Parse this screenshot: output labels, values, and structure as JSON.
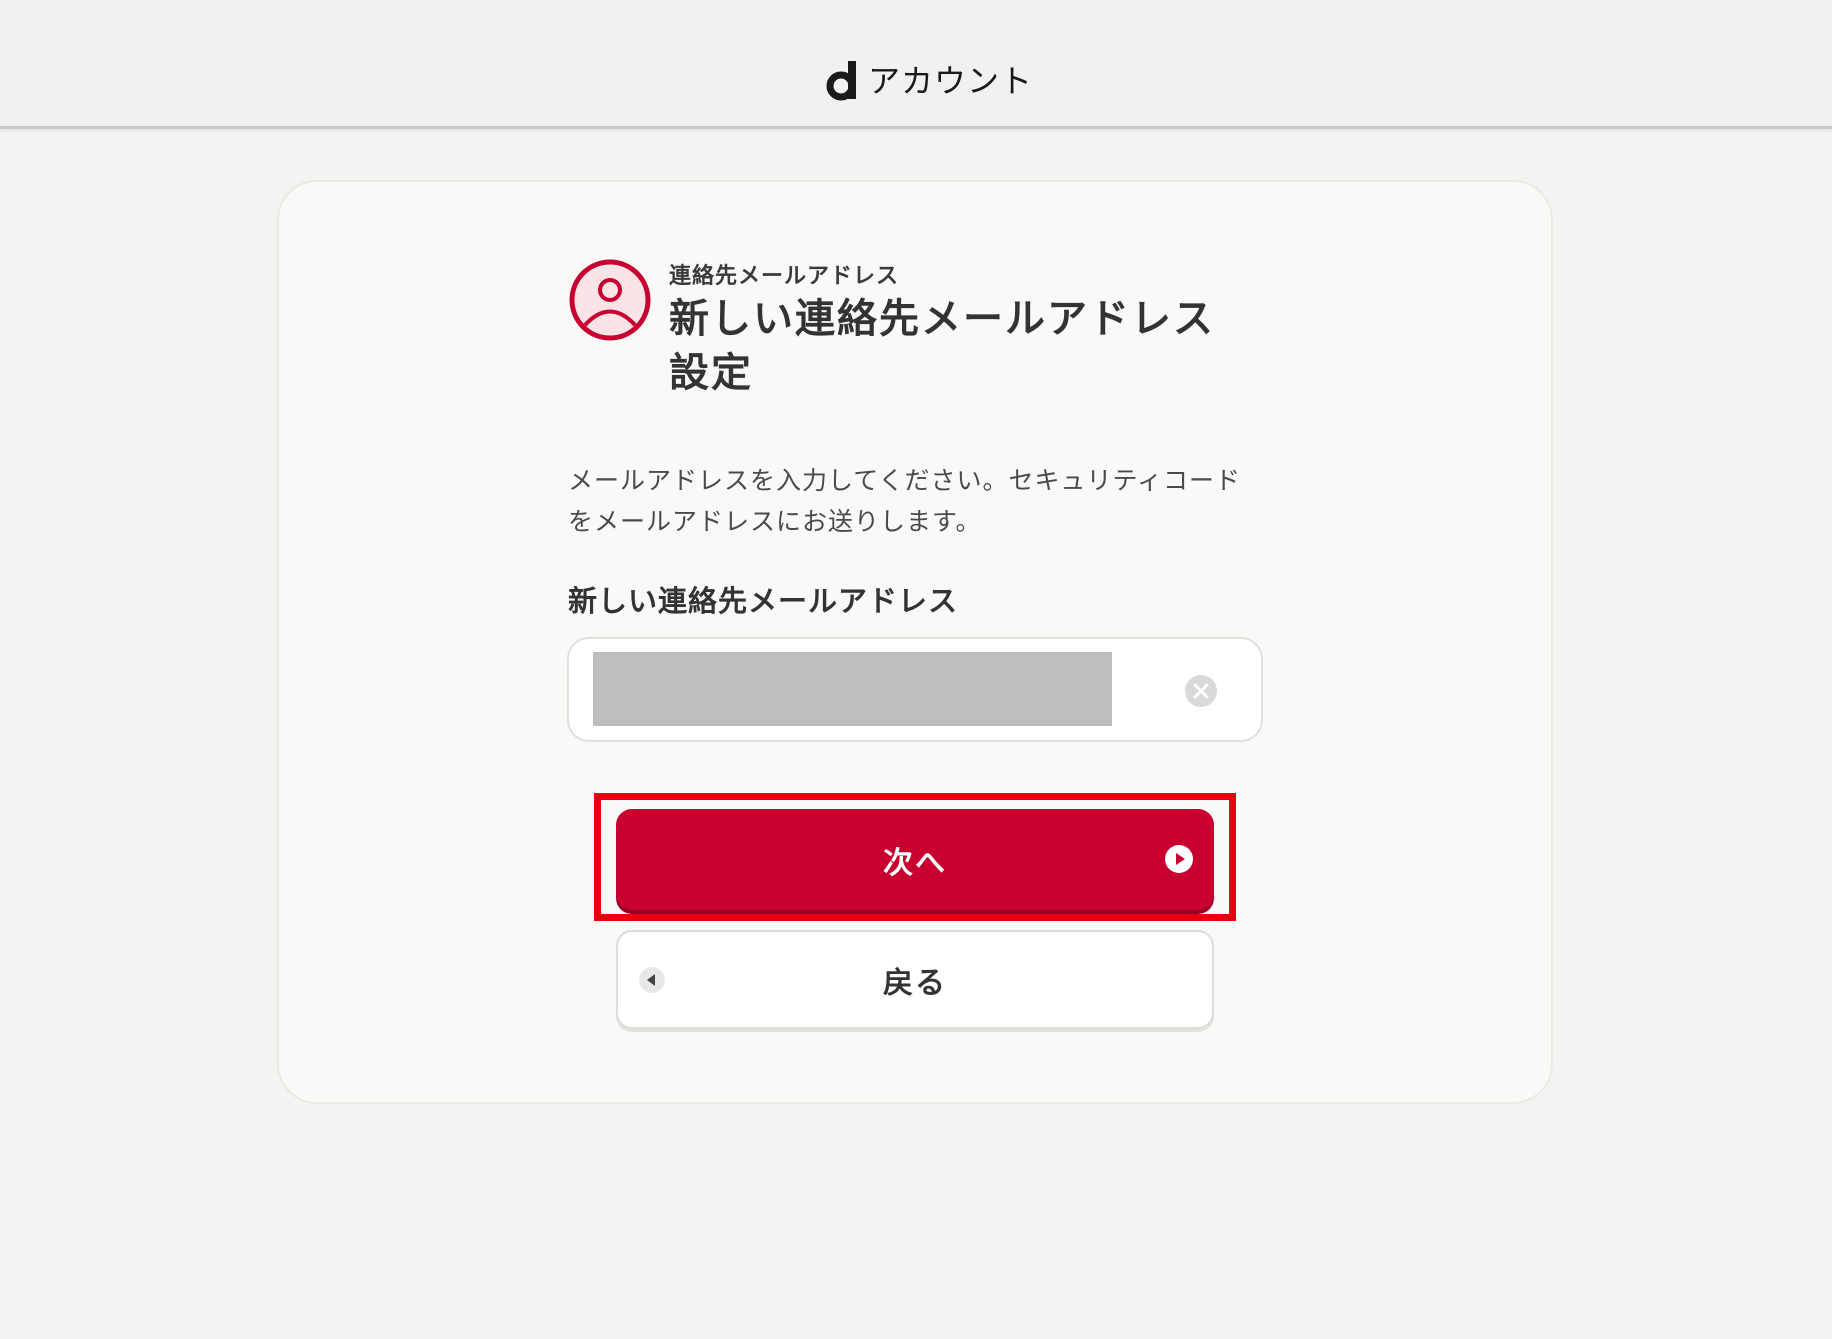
{
  "header": {
    "logo_letter": "d",
    "logo_text": "アカウント"
  },
  "card": {
    "icon": "user-circle-icon",
    "subtitle": "連絡先メールアドレス",
    "title": "新しい連絡先メールアドレス設定",
    "description": "メールアドレスを入力してください。セキュリティコードをメールアドレスにお送りします。",
    "field_label": "新しい連絡先メールアドレス",
    "email_value": "",
    "next_label": "次へ",
    "back_label": "戻る"
  },
  "colors": {
    "brand": "#c8002f",
    "highlight": "#e60012",
    "background": "#f4f3f1"
  }
}
